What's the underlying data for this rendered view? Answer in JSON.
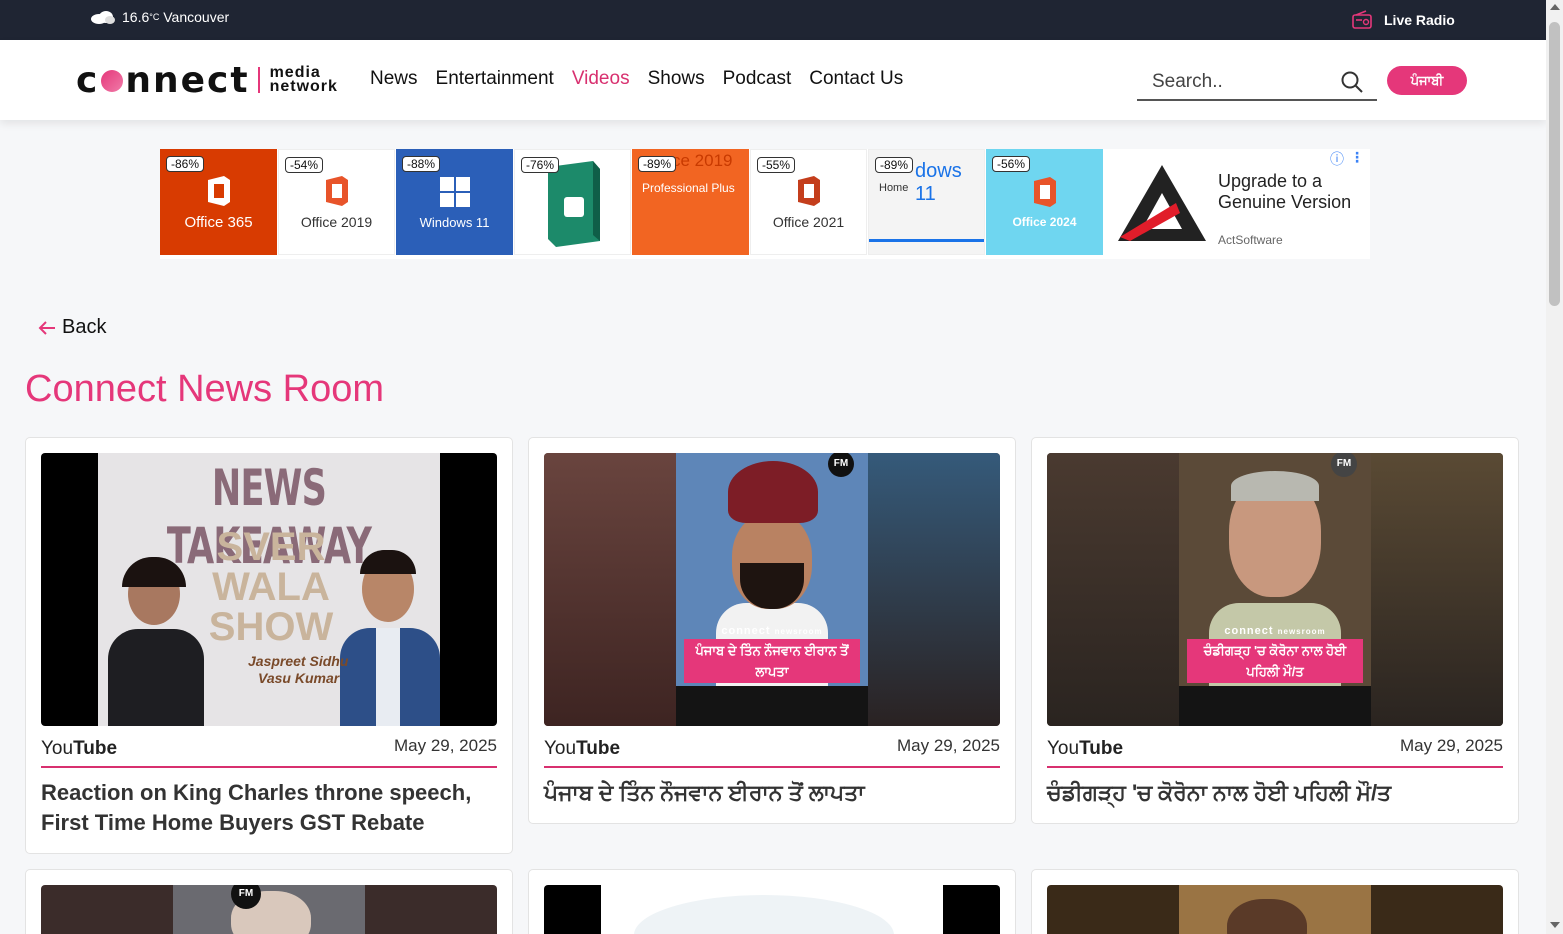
{
  "topbar": {
    "temperature": "16.6",
    "unit": "°C",
    "city": "Vancouver",
    "live_radio": "Live Radio",
    "icons": [
      "cloud-icon",
      "radio-icon"
    ]
  },
  "header": {
    "logo_main": "connect",
    "logo_sub_1": "media",
    "logo_sub_2": "network",
    "nav": [
      {
        "label": "News",
        "active": false
      },
      {
        "label": "Entertainment",
        "active": false
      },
      {
        "label": "Videos",
        "active": true
      },
      {
        "label": "Shows",
        "active": false
      },
      {
        "label": "Podcast",
        "active": false
      },
      {
        "label": "Contact Us",
        "active": false
      }
    ],
    "search_placeholder": "Search..",
    "lang_button": "ਪੰਜਾਬੀ"
  },
  "ad": {
    "tiles": [
      {
        "discount": "-86%",
        "name": "Office 365",
        "bg": "#d83b01",
        "fg": "#ffffff"
      },
      {
        "discount": "-54%",
        "name": "Office 2019",
        "bg": "#ffffff",
        "fg": "#333333"
      },
      {
        "discount": "-88%",
        "name": "Windows 11",
        "bg": "#2b5fb8",
        "fg": "#ffffff"
      },
      {
        "discount": "-76%",
        "name": "",
        "bg": "#ffffff",
        "fg": "#333333"
      },
      {
        "discount": "-89%",
        "name": "ce 2019",
        "sub": "Professional Plus",
        "bg": "#f26522",
        "fg": "#ffffff"
      },
      {
        "discount": "-55%",
        "name": "Office 2021",
        "bg": "#ffffff",
        "fg": "#333333"
      },
      {
        "discount": "-89%",
        "name": "dows 11",
        "sub": "Home",
        "bg": "#f4f4f4",
        "fg": "#1a73e8"
      },
      {
        "discount": "-56%",
        "name": "Office 2024",
        "bg": "#6fd6f0",
        "fg": "#ffffff"
      }
    ],
    "headline": "Upgrade to a Genuine Version",
    "brand": "ActSoftware"
  },
  "back_label": "Back",
  "section_title": "Connect News Room",
  "cards": [
    {
      "source_a": "You",
      "source_b": "Tube",
      "date": "May 29, 2025",
      "title": "Reaction on King Charles throne speech, First Time Home Buyers GST Rebate",
      "thumb_text_1": "NEWS TAKEAWAY",
      "thumb_text_2": "SVER WALA SHOW",
      "thumb_text_3": "Jaspreet Sidhu",
      "thumb_text_4": "Vasu Kumar"
    },
    {
      "source_a": "You",
      "source_b": "Tube",
      "date": "May 29, 2025",
      "title": "ਪੰਜਾਬ ਦੇ ਤਿੰਨ ਨੌਜਵਾਨ ਈਰਾਨ ਤੋਂ ਲਾਪਤਾ",
      "thumb_tag": "ਪੰਜਾਬ ਦੇ ਤਿੰਨ ਨੌਜਵਾਨ ਈਰਾਨ ਤੋਂ ਲਾਪਤਾ"
    },
    {
      "source_a": "You",
      "source_b": "Tube",
      "date": "May 29, 2025",
      "title": "ਚੰਡੀਗੜ੍ਹ 'ਚ ਕੋਰੋਨਾ ਨਾਲ ਹੋਈ ਪਹਿਲੀ ਮੌ/ਤ",
      "thumb_tag": "ਚੰਡੀਗੜ੍ਹ 'ਚ ਕੋਰੋਨਾ ਨਾਲ ਹੋਈ ਪਹਿਲੀ ਮੌ/ਤ"
    }
  ],
  "thumb_logo": "connect",
  "thumb_logo_sub": "newsroom",
  "colors": {
    "accent": "#e5377a",
    "topbar": "#1f2533",
    "nav_active": "#d8306f"
  }
}
